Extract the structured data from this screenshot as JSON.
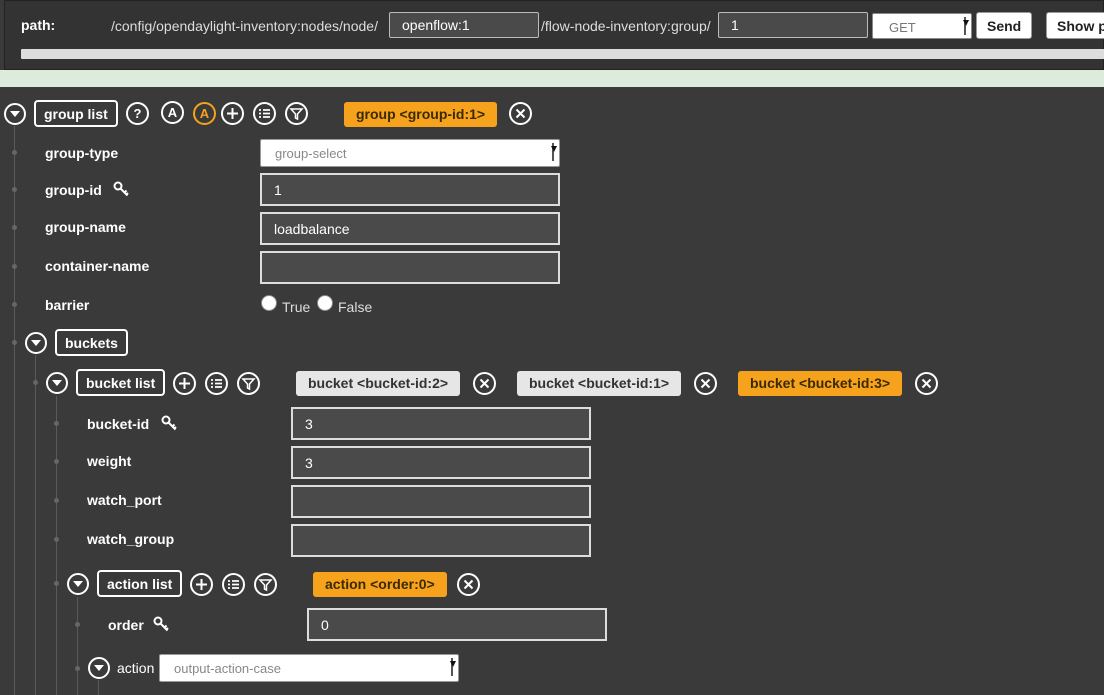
{
  "path_bar": {
    "label": "path:",
    "prefix": "/config/opendaylight-inventory:nodes/node/",
    "node_value": "openflow:1",
    "middle": "/flow-node-inventory:group/",
    "group_value": "1",
    "method": "GET",
    "send_label": "Send",
    "show_label": "Show p"
  },
  "group_list": {
    "label": "group list",
    "help": "?",
    "a1": "A",
    "a2": "A",
    "active_tag": "group  <group-id:1>"
  },
  "group_fields": {
    "type_label": "group-type",
    "type_value": "group-select",
    "id_label": "group-id",
    "id_value": "1",
    "name_label": "group-name",
    "name_value": "loadbalance",
    "container_label": "container-name",
    "container_value": "",
    "barrier_label": "barrier",
    "true_label": "True",
    "false_label": "False"
  },
  "buckets": {
    "label": "buckets",
    "list_label": "bucket list",
    "tags": [
      {
        "label": "bucket  <bucket-id:2>",
        "active": false
      },
      {
        "label": "bucket  <bucket-id:1>",
        "active": false
      },
      {
        "label": "bucket  <bucket-id:3>",
        "active": true
      }
    ]
  },
  "bucket_fields": {
    "id_label": "bucket-id",
    "id_value": "3",
    "weight_label": "weight",
    "weight_value": "3",
    "watch_port_label": "watch_port",
    "watch_port_value": "",
    "watch_group_label": "watch_group",
    "watch_group_value": ""
  },
  "action_list": {
    "label": "action list",
    "active_tag": "action  <order:0>",
    "order_label": "order",
    "order_value": "0",
    "action_label": "action",
    "action_value": "output-action-case"
  },
  "colors": {
    "accent": "#f7a21c",
    "background": "#3a3a3a"
  }
}
